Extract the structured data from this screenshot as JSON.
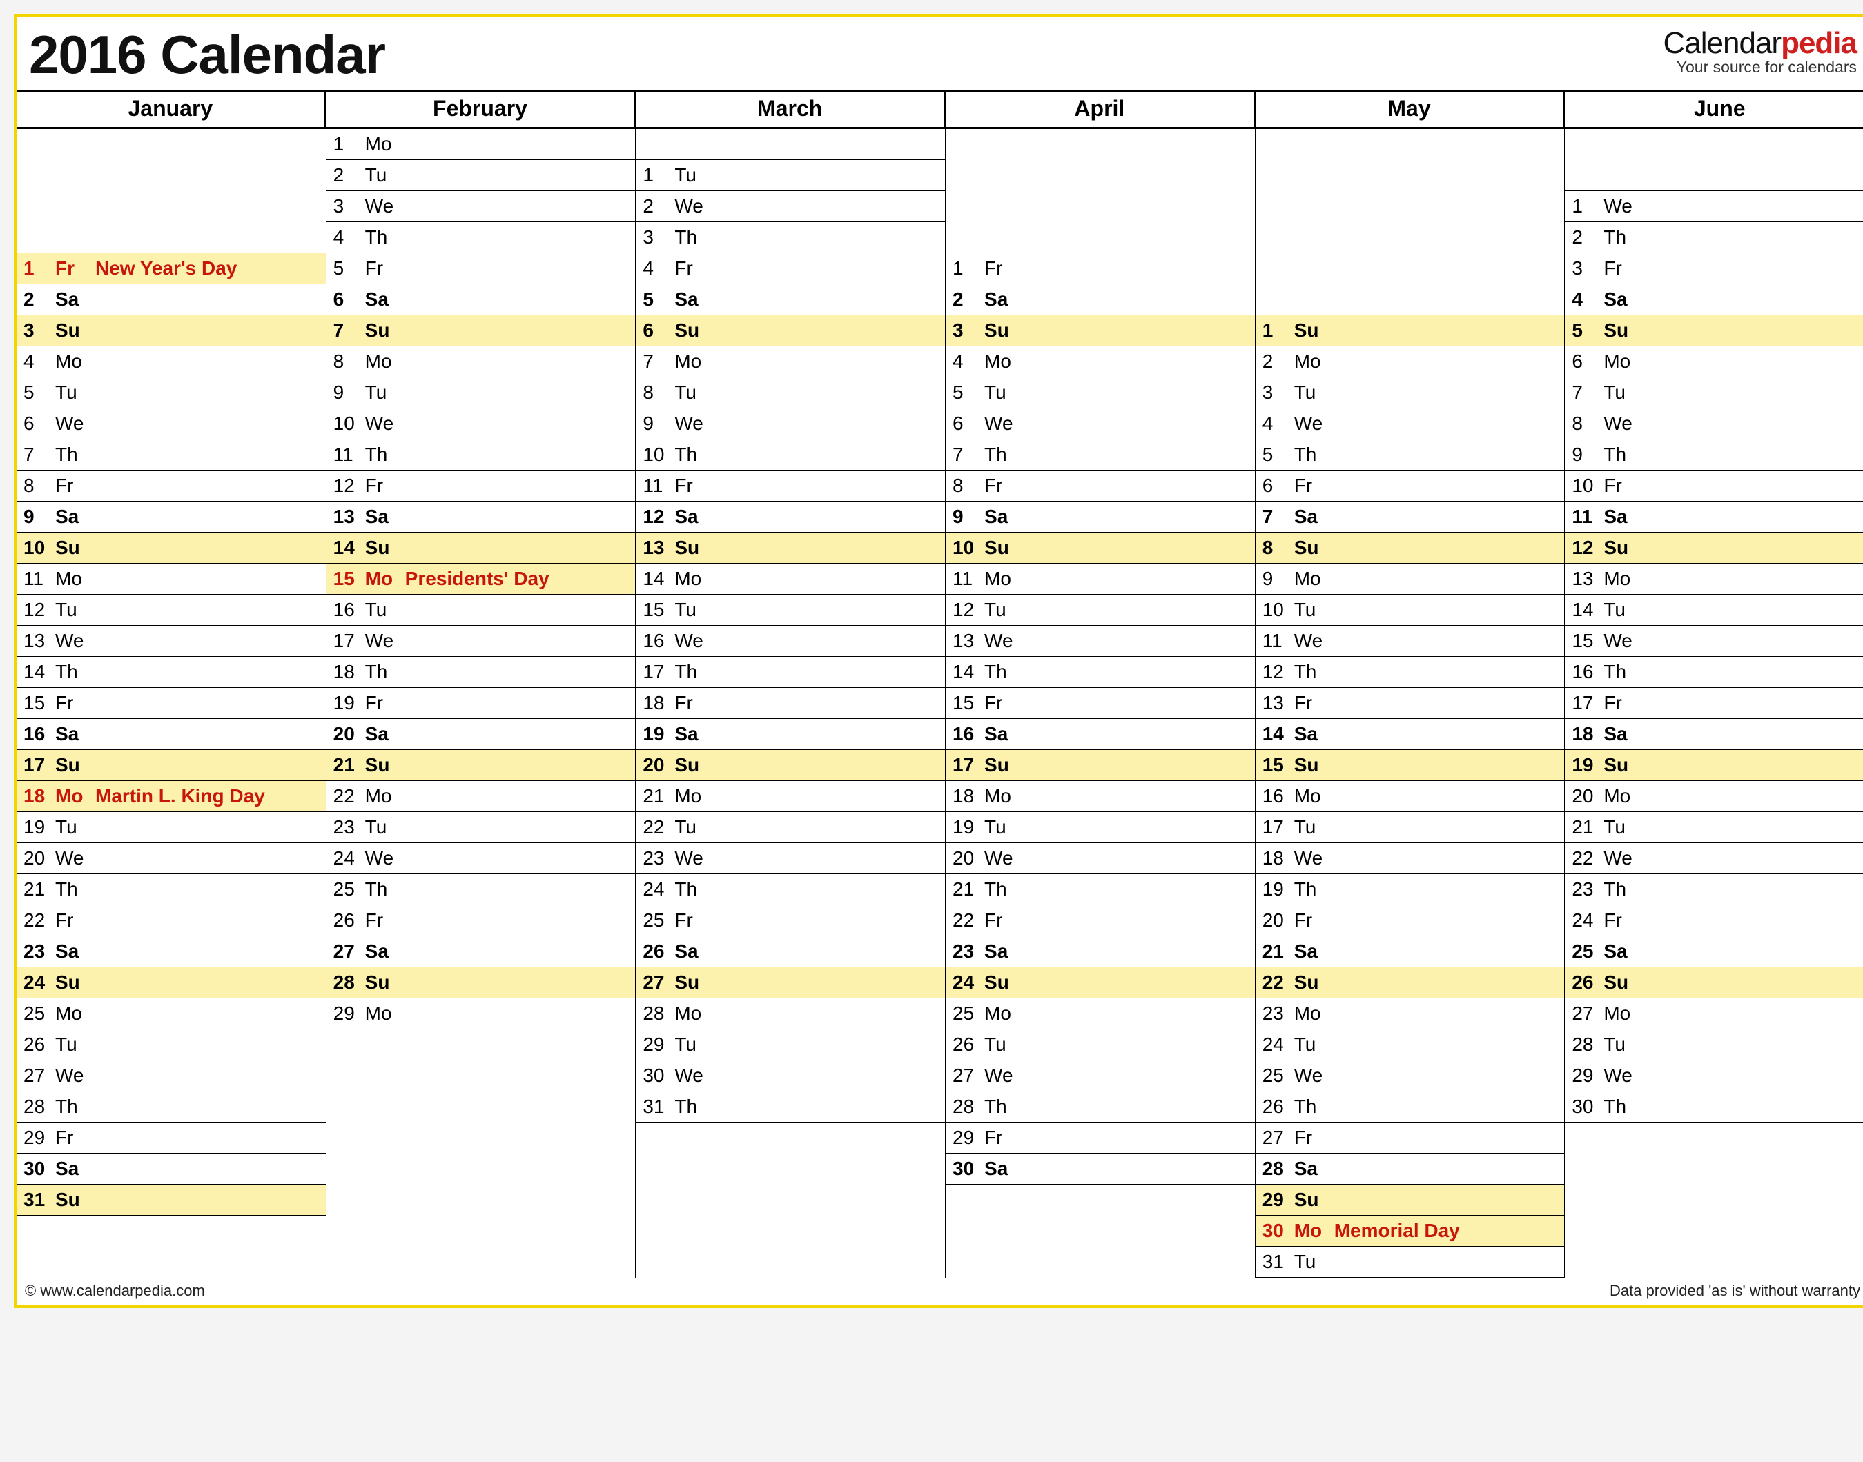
{
  "title": "2016 Calendar",
  "brand": {
    "part1": "Calendar",
    "part2": "pedia",
    "tagline": "Your source for calendars"
  },
  "footer": {
    "left": "© www.calendarpedia.com",
    "right": "Data provided 'as is' without warranty"
  },
  "months": [
    {
      "name": "January",
      "leadingBlanks": 4,
      "days": [
        {
          "n": 1,
          "d": "Fr",
          "t": "New Year's Day",
          "c": "hol"
        },
        {
          "n": 2,
          "d": "Sa",
          "c": "sat"
        },
        {
          "n": 3,
          "d": "Su",
          "c": "sun"
        },
        {
          "n": 4,
          "d": "Mo"
        },
        {
          "n": 5,
          "d": "Tu"
        },
        {
          "n": 6,
          "d": "We"
        },
        {
          "n": 7,
          "d": "Th"
        },
        {
          "n": 8,
          "d": "Fr"
        },
        {
          "n": 9,
          "d": "Sa",
          "c": "sat"
        },
        {
          "n": 10,
          "d": "Su",
          "c": "sun"
        },
        {
          "n": 11,
          "d": "Mo"
        },
        {
          "n": 12,
          "d": "Tu"
        },
        {
          "n": 13,
          "d": "We"
        },
        {
          "n": 14,
          "d": "Th"
        },
        {
          "n": 15,
          "d": "Fr"
        },
        {
          "n": 16,
          "d": "Sa",
          "c": "sat"
        },
        {
          "n": 17,
          "d": "Su",
          "c": "sun"
        },
        {
          "n": 18,
          "d": "Mo",
          "t": "Martin L. King Day",
          "c": "hol"
        },
        {
          "n": 19,
          "d": "Tu"
        },
        {
          "n": 20,
          "d": "We"
        },
        {
          "n": 21,
          "d": "Th"
        },
        {
          "n": 22,
          "d": "Fr"
        },
        {
          "n": 23,
          "d": "Sa",
          "c": "sat"
        },
        {
          "n": 24,
          "d": "Su",
          "c": "sun"
        },
        {
          "n": 25,
          "d": "Mo"
        },
        {
          "n": 26,
          "d": "Tu"
        },
        {
          "n": 27,
          "d": "We"
        },
        {
          "n": 28,
          "d": "Th"
        },
        {
          "n": 29,
          "d": "Fr"
        },
        {
          "n": 30,
          "d": "Sa",
          "c": "sat"
        },
        {
          "n": 31,
          "d": "Su",
          "c": "sun"
        }
      ]
    },
    {
      "name": "February",
      "leadingBlanks": 0,
      "days": [
        {
          "n": 1,
          "d": "Mo"
        },
        {
          "n": 2,
          "d": "Tu"
        },
        {
          "n": 3,
          "d": "We"
        },
        {
          "n": 4,
          "d": "Th"
        },
        {
          "n": 5,
          "d": "Fr"
        },
        {
          "n": 6,
          "d": "Sa",
          "c": "sat"
        },
        {
          "n": 7,
          "d": "Su",
          "c": "sun"
        },
        {
          "n": 8,
          "d": "Mo"
        },
        {
          "n": 9,
          "d": "Tu"
        },
        {
          "n": 10,
          "d": "We"
        },
        {
          "n": 11,
          "d": "Th"
        },
        {
          "n": 12,
          "d": "Fr"
        },
        {
          "n": 13,
          "d": "Sa",
          "c": "sat"
        },
        {
          "n": 14,
          "d": "Su",
          "c": "sun"
        },
        {
          "n": 15,
          "d": "Mo",
          "t": "Presidents' Day",
          "c": "hol"
        },
        {
          "n": 16,
          "d": "Tu"
        },
        {
          "n": 17,
          "d": "We"
        },
        {
          "n": 18,
          "d": "Th"
        },
        {
          "n": 19,
          "d": "Fr"
        },
        {
          "n": 20,
          "d": "Sa",
          "c": "sat"
        },
        {
          "n": 21,
          "d": "Su",
          "c": "sun"
        },
        {
          "n": 22,
          "d": "Mo"
        },
        {
          "n": 23,
          "d": "Tu"
        },
        {
          "n": 24,
          "d": "We"
        },
        {
          "n": 25,
          "d": "Th"
        },
        {
          "n": 26,
          "d": "Fr"
        },
        {
          "n": 27,
          "d": "Sa",
          "c": "sat"
        },
        {
          "n": 28,
          "d": "Su",
          "c": "sun"
        },
        {
          "n": 29,
          "d": "Mo"
        }
      ]
    },
    {
      "name": "March",
      "leadingBlanks": 1,
      "days": [
        {
          "n": 1,
          "d": "Tu"
        },
        {
          "n": 2,
          "d": "We"
        },
        {
          "n": 3,
          "d": "Th"
        },
        {
          "n": 4,
          "d": "Fr"
        },
        {
          "n": 5,
          "d": "Sa",
          "c": "sat"
        },
        {
          "n": 6,
          "d": "Su",
          "c": "sun"
        },
        {
          "n": 7,
          "d": "Mo"
        },
        {
          "n": 8,
          "d": "Tu"
        },
        {
          "n": 9,
          "d": "We"
        },
        {
          "n": 10,
          "d": "Th"
        },
        {
          "n": 11,
          "d": "Fr"
        },
        {
          "n": 12,
          "d": "Sa",
          "c": "sat"
        },
        {
          "n": 13,
          "d": "Su",
          "c": "sun"
        },
        {
          "n": 14,
          "d": "Mo"
        },
        {
          "n": 15,
          "d": "Tu"
        },
        {
          "n": 16,
          "d": "We"
        },
        {
          "n": 17,
          "d": "Th"
        },
        {
          "n": 18,
          "d": "Fr"
        },
        {
          "n": 19,
          "d": "Sa",
          "c": "sat"
        },
        {
          "n": 20,
          "d": "Su",
          "c": "sun"
        },
        {
          "n": 21,
          "d": "Mo"
        },
        {
          "n": 22,
          "d": "Tu"
        },
        {
          "n": 23,
          "d": "We"
        },
        {
          "n": 24,
          "d": "Th"
        },
        {
          "n": 25,
          "d": "Fr"
        },
        {
          "n": 26,
          "d": "Sa",
          "c": "sat"
        },
        {
          "n": 27,
          "d": "Su",
          "c": "sun"
        },
        {
          "n": 28,
          "d": "Mo"
        },
        {
          "n": 29,
          "d": "Tu"
        },
        {
          "n": 30,
          "d": "We"
        },
        {
          "n": 31,
          "d": "Th"
        }
      ]
    },
    {
      "name": "April",
      "leadingBlanks": 4,
      "days": [
        {
          "n": 1,
          "d": "Fr"
        },
        {
          "n": 2,
          "d": "Sa",
          "c": "sat"
        },
        {
          "n": 3,
          "d": "Su",
          "c": "sun"
        },
        {
          "n": 4,
          "d": "Mo"
        },
        {
          "n": 5,
          "d": "Tu"
        },
        {
          "n": 6,
          "d": "We"
        },
        {
          "n": 7,
          "d": "Th"
        },
        {
          "n": 8,
          "d": "Fr"
        },
        {
          "n": 9,
          "d": "Sa",
          "c": "sat"
        },
        {
          "n": 10,
          "d": "Su",
          "c": "sun"
        },
        {
          "n": 11,
          "d": "Mo"
        },
        {
          "n": 12,
          "d": "Tu"
        },
        {
          "n": 13,
          "d": "We"
        },
        {
          "n": 14,
          "d": "Th"
        },
        {
          "n": 15,
          "d": "Fr"
        },
        {
          "n": 16,
          "d": "Sa",
          "c": "sat"
        },
        {
          "n": 17,
          "d": "Su",
          "c": "sun"
        },
        {
          "n": 18,
          "d": "Mo"
        },
        {
          "n": 19,
          "d": "Tu"
        },
        {
          "n": 20,
          "d": "We"
        },
        {
          "n": 21,
          "d": "Th"
        },
        {
          "n": 22,
          "d": "Fr"
        },
        {
          "n": 23,
          "d": "Sa",
          "c": "sat"
        },
        {
          "n": 24,
          "d": "Su",
          "c": "sun"
        },
        {
          "n": 25,
          "d": "Mo"
        },
        {
          "n": 26,
          "d": "Tu"
        },
        {
          "n": 27,
          "d": "We"
        },
        {
          "n": 28,
          "d": "Th"
        },
        {
          "n": 29,
          "d": "Fr"
        },
        {
          "n": 30,
          "d": "Sa",
          "c": "sat"
        }
      ]
    },
    {
      "name": "May",
      "leadingBlanks": 6,
      "days": [
        {
          "n": 1,
          "d": "Su",
          "c": "sun"
        },
        {
          "n": 2,
          "d": "Mo"
        },
        {
          "n": 3,
          "d": "Tu"
        },
        {
          "n": 4,
          "d": "We"
        },
        {
          "n": 5,
          "d": "Th"
        },
        {
          "n": 6,
          "d": "Fr"
        },
        {
          "n": 7,
          "d": "Sa",
          "c": "sat"
        },
        {
          "n": 8,
          "d": "Su",
          "c": "sun"
        },
        {
          "n": 9,
          "d": "Mo"
        },
        {
          "n": 10,
          "d": "Tu"
        },
        {
          "n": 11,
          "d": "We"
        },
        {
          "n": 12,
          "d": "Th"
        },
        {
          "n": 13,
          "d": "Fr"
        },
        {
          "n": 14,
          "d": "Sa",
          "c": "sat"
        },
        {
          "n": 15,
          "d": "Su",
          "c": "sun"
        },
        {
          "n": 16,
          "d": "Mo"
        },
        {
          "n": 17,
          "d": "Tu"
        },
        {
          "n": 18,
          "d": "We"
        },
        {
          "n": 19,
          "d": "Th"
        },
        {
          "n": 20,
          "d": "Fr"
        },
        {
          "n": 21,
          "d": "Sa",
          "c": "sat"
        },
        {
          "n": 22,
          "d": "Su",
          "c": "sun"
        },
        {
          "n": 23,
          "d": "Mo"
        },
        {
          "n": 24,
          "d": "Tu"
        },
        {
          "n": 25,
          "d": "We"
        },
        {
          "n": 26,
          "d": "Th"
        },
        {
          "n": 27,
          "d": "Fr"
        },
        {
          "n": 28,
          "d": "Sa",
          "c": "sat"
        },
        {
          "n": 29,
          "d": "Su",
          "c": "sun"
        },
        {
          "n": 30,
          "d": "Mo",
          "t": "Memorial Day",
          "c": "hol"
        },
        {
          "n": 31,
          "d": "Tu"
        }
      ]
    },
    {
      "name": "June",
      "leadingBlanks": 2,
      "days": [
        {
          "n": 1,
          "d": "We"
        },
        {
          "n": 2,
          "d": "Th"
        },
        {
          "n": 3,
          "d": "Fr"
        },
        {
          "n": 4,
          "d": "Sa",
          "c": "sat"
        },
        {
          "n": 5,
          "d": "Su",
          "c": "sun"
        },
        {
          "n": 6,
          "d": "Mo"
        },
        {
          "n": 7,
          "d": "Tu"
        },
        {
          "n": 8,
          "d": "We"
        },
        {
          "n": 9,
          "d": "Th"
        },
        {
          "n": 10,
          "d": "Fr"
        },
        {
          "n": 11,
          "d": "Sa",
          "c": "sat"
        },
        {
          "n": 12,
          "d": "Su",
          "c": "sun"
        },
        {
          "n": 13,
          "d": "Mo"
        },
        {
          "n": 14,
          "d": "Tu"
        },
        {
          "n": 15,
          "d": "We"
        },
        {
          "n": 16,
          "d": "Th"
        },
        {
          "n": 17,
          "d": "Fr"
        },
        {
          "n": 18,
          "d": "Sa",
          "c": "sat"
        },
        {
          "n": 19,
          "d": "Su",
          "c": "sun"
        },
        {
          "n": 20,
          "d": "Mo"
        },
        {
          "n": 21,
          "d": "Tu"
        },
        {
          "n": 22,
          "d": "We"
        },
        {
          "n": 23,
          "d": "Th"
        },
        {
          "n": 24,
          "d": "Fr"
        },
        {
          "n": 25,
          "d": "Sa",
          "c": "sat"
        },
        {
          "n": 26,
          "d": "Su",
          "c": "sun"
        },
        {
          "n": 27,
          "d": "Mo"
        },
        {
          "n": 28,
          "d": "Tu"
        },
        {
          "n": 29,
          "d": "We"
        },
        {
          "n": 30,
          "d": "Th"
        }
      ]
    }
  ]
}
